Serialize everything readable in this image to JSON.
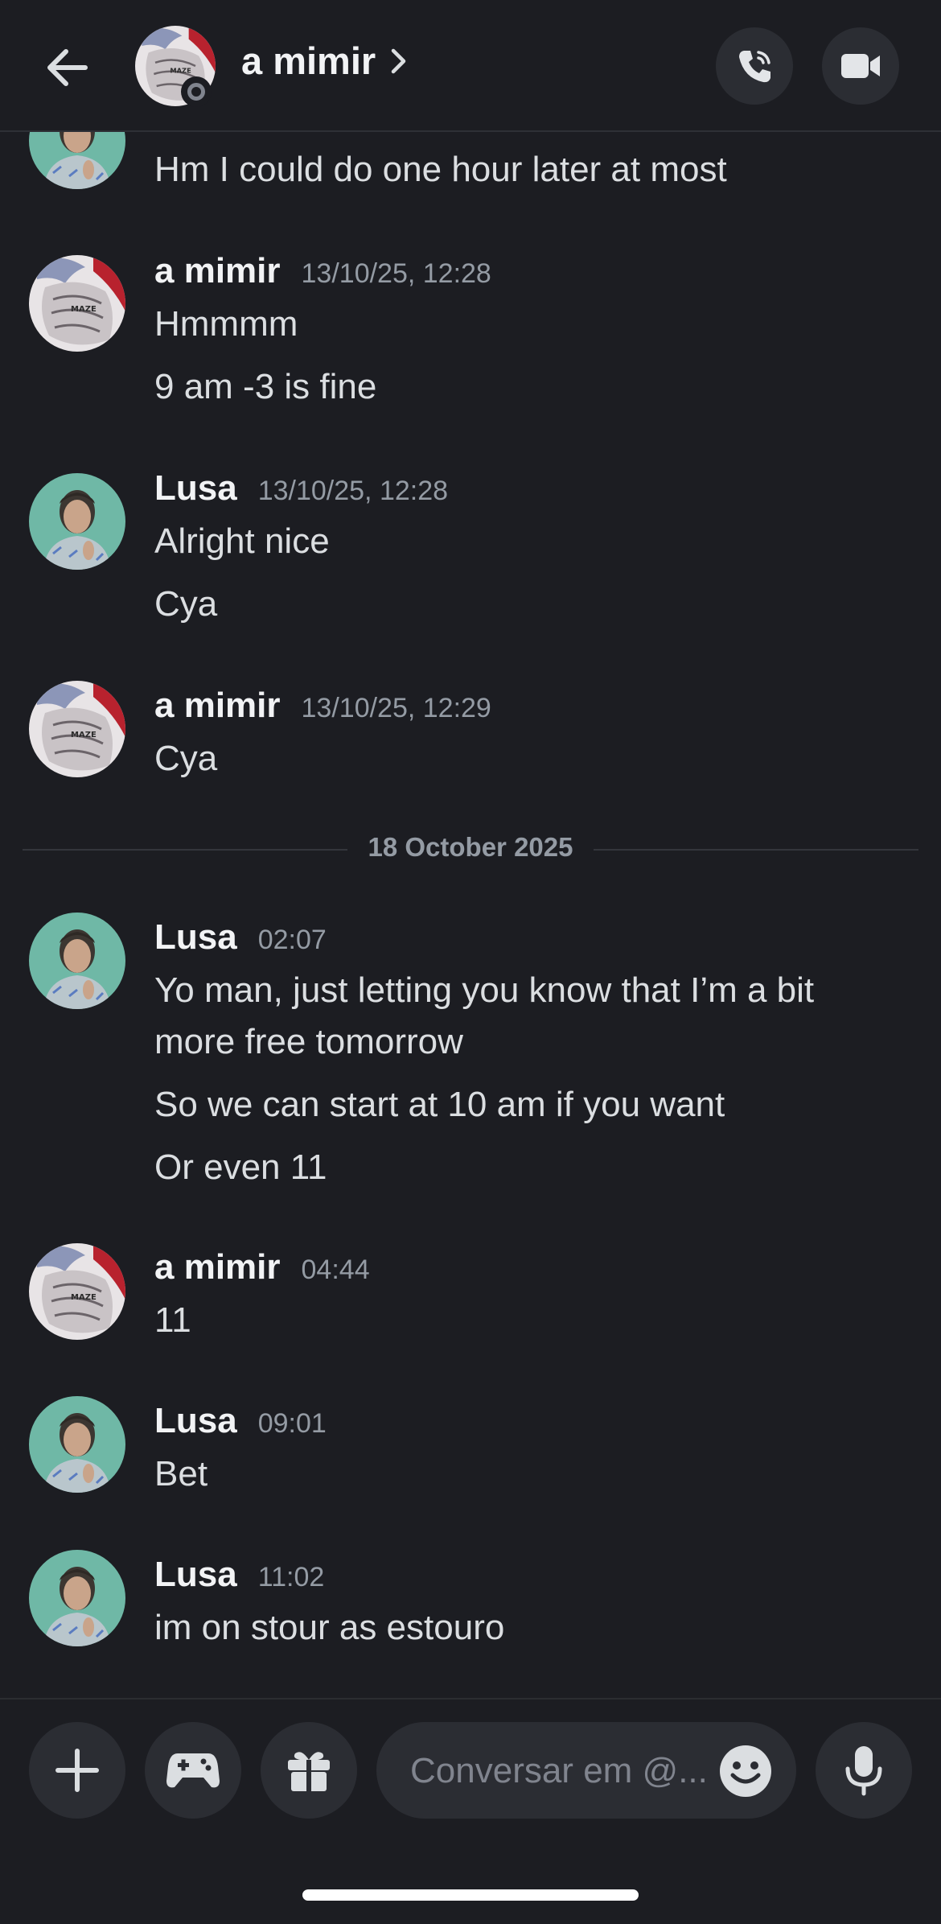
{
  "header": {
    "title": "a mimir",
    "status": "offline"
  },
  "messages": [
    {
      "author": "Lusa",
      "time": "",
      "lines": [
        "Hm I could do one hour later at most"
      ]
    },
    {
      "author": "a mimir",
      "time": "13/10/25, 12:28",
      "lines": [
        "Hmmmm",
        "9 am -3 is fine"
      ]
    },
    {
      "author": "Lusa",
      "time": "13/10/25, 12:28",
      "lines": [
        "Alright nice",
        "Cya"
      ]
    },
    {
      "author": "a mimir",
      "time": "13/10/25, 12:29",
      "lines": [
        "Cya"
      ]
    },
    {
      "author": "Lusa",
      "time": "02:07",
      "lines": [
        "Yo man, just letting you know that I’m a bit",
        "more free tomorrow",
        "So we can start at 10 am if you want",
        "Or even 11"
      ]
    },
    {
      "author": "a mimir",
      "time": "04:44",
      "lines": [
        "11"
      ]
    },
    {
      "author": "Lusa",
      "time": "09:01",
      "lines": [
        "Bet"
      ]
    },
    {
      "author": "Lusa",
      "time": "11:02",
      "lines": [
        "im on stour as estouro"
      ]
    }
  ],
  "date_divider": "18 October 2025",
  "composer": {
    "placeholder": "Conversar em @..."
  },
  "colors": {
    "background": "#1c1d22",
    "surface": "#2b2d33",
    "muted_text": "#949ba4"
  }
}
